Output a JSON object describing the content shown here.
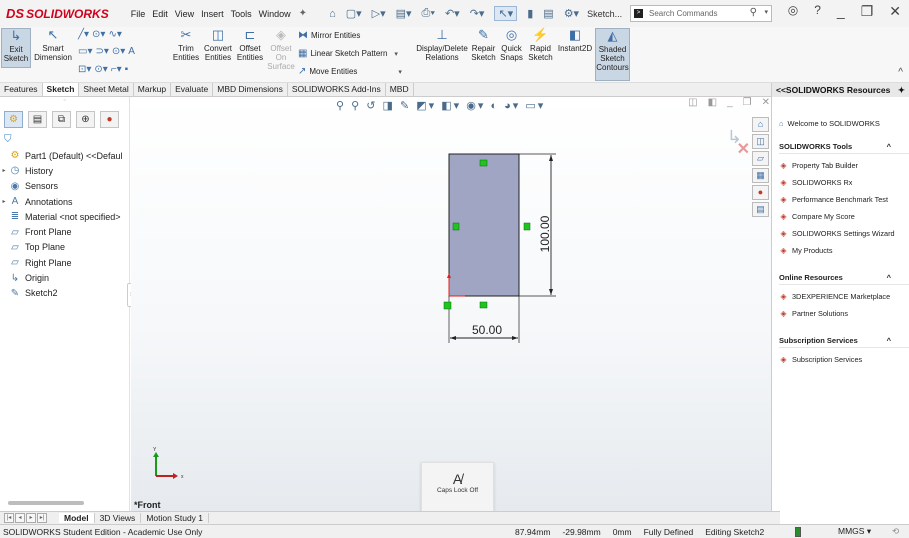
{
  "app": {
    "logo_text": "SOLIDWORKS",
    "logo_prefix": "DS",
    "menus": [
      "File",
      "Edit",
      "View",
      "Insert",
      "Tools",
      "Window"
    ],
    "sketch_dropdown": "Sketch...",
    "search_placeholder": "Search Commands"
  },
  "ribbon": {
    "exit_sketch": "Exit\nSketch",
    "smart_dimension": "Smart\nDimension",
    "trim": "Trim\nEntities",
    "convert": "Convert\nEntities",
    "offset": "Offset\nEntities",
    "offset_surface": "Offset\nOn\nSurface",
    "mirror": "Mirror Entities",
    "linear_pattern": "Linear Sketch Pattern",
    "move": "Move Entities",
    "display_delete": "Display/Delete\nRelations",
    "repair": "Repair\nSketch",
    "quick_snaps": "Quick\nSnaps",
    "rapid": "Rapid\nSketch",
    "instant2d": "Instant2D",
    "shaded": "Shaded\nSketch\nContours"
  },
  "tabs": [
    "Features",
    "Sketch",
    "Sheet Metal",
    "Markup",
    "Evaluate",
    "MBD Dimensions",
    "SOLIDWORKS Add-Ins",
    "MBD"
  ],
  "tree": [
    {
      "label": "Part1 (Default) <<Defaul",
      "icon": "part-icon",
      "glyph": "⚙",
      "exp": ""
    },
    {
      "label": "History",
      "icon": "history-icon",
      "glyph": "◷",
      "exp": "▸"
    },
    {
      "label": "Sensors",
      "icon": "sensors-icon",
      "glyph": "◉",
      "exp": ""
    },
    {
      "label": "Annotations",
      "icon": "annotations-icon",
      "glyph": "A",
      "exp": "▸"
    },
    {
      "label": "Material <not specified>",
      "icon": "material-icon",
      "glyph": "≣",
      "exp": ""
    },
    {
      "label": "Front Plane",
      "icon": "plane-icon",
      "glyph": "▱",
      "exp": ""
    },
    {
      "label": "Top Plane",
      "icon": "plane-icon",
      "glyph": "▱",
      "exp": ""
    },
    {
      "label": "Right Plane",
      "icon": "plane-icon",
      "glyph": "▱",
      "exp": ""
    },
    {
      "label": "Origin",
      "icon": "origin-icon",
      "glyph": "↳",
      "exp": ""
    },
    {
      "label": "Sketch2",
      "icon": "sketch-icon",
      "glyph": "✎",
      "exp": ""
    }
  ],
  "graphics": {
    "view_name": "*Front",
    "dim_vertical": "100.00",
    "dim_horizontal": "50.00",
    "caps_lock": "Caps Lock Off",
    "triad_x": "x",
    "triad_y": "Y"
  },
  "taskpane": {
    "title": "<<SOLIDWORKS Resources",
    "welcome": "Welcome to SOLIDWORKS",
    "sections": [
      {
        "title": "SOLIDWORKS Tools",
        "items": [
          "Property Tab Builder",
          "SOLIDWORKS Rx",
          "Performance Benchmark Test",
          "Compare My Score",
          "SOLIDWORKS Settings Wizard",
          "My Products"
        ]
      },
      {
        "title": "Online Resources",
        "items": [
          "3DEXPERIENCE Marketplace",
          "Partner Solutions"
        ]
      },
      {
        "title": "Subscription Services",
        "items": [
          "Subscription Services"
        ]
      }
    ]
  },
  "bottom_tabs": [
    "Model",
    "3D Views",
    "Motion Study 1"
  ],
  "status": {
    "edition": "SOLIDWORKS Student Edition - Academic Use Only",
    "x": "87.94mm",
    "y": "-29.98mm",
    "z": "0mm",
    "state": "Fully Defined",
    "editing": "Editing Sketch2",
    "units": "MMGS"
  },
  "colors": {
    "brand": "#d0021b",
    "sketch_fill": "#9fa5c2",
    "handle": "#1ec51e"
  }
}
